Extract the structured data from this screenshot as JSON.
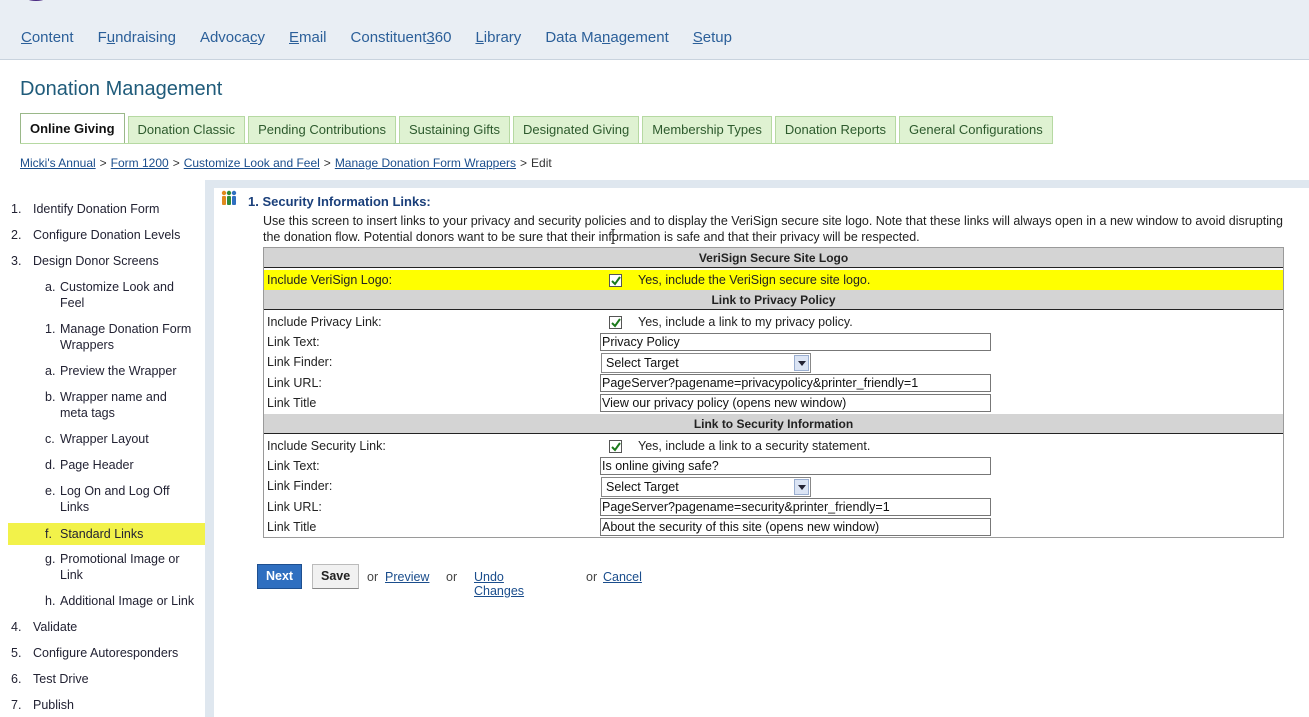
{
  "app": {
    "logo_fragment": "convio"
  },
  "nav": [
    {
      "label": "Content",
      "access": "C",
      "rest": "ontent"
    },
    {
      "label": "Fundraising",
      "access": "u",
      "pre": "F",
      "rest": "ndraising"
    },
    {
      "label": "Advocacy",
      "pre": "Advoca",
      "access": "c",
      "rest": "y"
    },
    {
      "label": "Email",
      "access": "E",
      "rest": "mail"
    },
    {
      "label": "Constituent360",
      "pre": "Constituent",
      "access": "3",
      "rest": "60"
    },
    {
      "label": "Library",
      "access": "L",
      "rest": "ibrary"
    },
    {
      "label": "Data Management",
      "pre": "Data Ma",
      "access": "n",
      "rest": "agement"
    },
    {
      "label": "Setup",
      "access": "S",
      "rest": "etup"
    }
  ],
  "page_title": "Donation Management",
  "tabs": [
    {
      "label": "Online Giving",
      "active": true
    },
    {
      "label": "Donation Classic"
    },
    {
      "label": "Pending Contributions"
    },
    {
      "label": "Sustaining Gifts"
    },
    {
      "label": "Designated Giving"
    },
    {
      "label": "Membership Types"
    },
    {
      "label": "Donation Reports"
    },
    {
      "label": "General Configurations"
    }
  ],
  "breadcrumb": {
    "items": [
      "Micki's Annual",
      "Form 1200",
      "Customize Look and Feel",
      "Manage Donation Form Wrappers"
    ],
    "current": "Edit",
    "sep": ">"
  },
  "steps": [
    {
      "num": "1.",
      "label": "Identify Donation Form"
    },
    {
      "num": "2.",
      "label": "Configure Donation Levels"
    },
    {
      "num": "3.",
      "label": "Design Donor Screens"
    },
    {
      "num": "a.",
      "label1": "Customize Look and",
      "label2": "Feel"
    },
    {
      "num": "1.",
      "label1": "Manage Donation Form",
      "label2": "Wrappers"
    },
    {
      "num": "a.",
      "label": "Preview the Wrapper"
    },
    {
      "num": "b.",
      "label1": "Wrapper name and",
      "label2": "meta tags"
    },
    {
      "num": "c.",
      "label": "Wrapper Layout"
    },
    {
      "num": "d.",
      "label": "Page Header"
    },
    {
      "num": "e.",
      "label1": "Log On and Log Off",
      "label2": "Links"
    },
    {
      "num": "f.",
      "label": "Standard Links",
      "highlighted": true
    },
    {
      "num": "g.",
      "label1": "Promotional Image or",
      "label2": "Link"
    },
    {
      "num": "h.",
      "label": "Additional Image or Link"
    },
    {
      "num": "4.",
      "label": "Validate"
    },
    {
      "num": "5.",
      "label": "Configure Autoresponders"
    },
    {
      "num": "6.",
      "label": "Test Drive"
    },
    {
      "num": "7.",
      "label": "Publish"
    }
  ],
  "section": {
    "title": "1. Security Information Links:",
    "intro": "Use this screen to insert links to your privacy and security policies and to display the VeriSign secure site logo. Note that these links will always open in a new window to avoid disrupting the donation flow. Potential donors want to be sure that their information is safe and that their privacy will be respected."
  },
  "verisign": {
    "header": "VeriSign Secure Site Logo",
    "label": "Include VeriSign Logo:",
    "checked": true,
    "checkbox_text": "Yes, include the VeriSign secure site logo."
  },
  "privacy": {
    "header": "Link to Privacy Policy",
    "include_label": "Include Privacy Link:",
    "checked": true,
    "checkbox_text": "Yes, include a link to my privacy policy.",
    "text_label": "Link Text:",
    "text_value": "Privacy Policy",
    "finder_label": "Link Finder:",
    "finder_value": "Select Target",
    "url_label": "Link URL:",
    "url_value": "PageServer?pagename=privacypolicy&printer_friendly=1",
    "title_label": "Link Title",
    "title_value": "View our privacy policy (opens new window)"
  },
  "security": {
    "header": "Link to Security Information",
    "include_label": "Include Security Link:",
    "checked": true,
    "checkbox_text": "Yes, include a link to a security statement.",
    "text_label": "Link Text:",
    "text_value": "Is online giving safe?",
    "finder_label": "Link Finder:",
    "finder_value": "Select Target",
    "url_label": "Link URL:",
    "url_value": "PageServer?pagename=security&printer_friendly=1",
    "title_label": "Link Title",
    "title_value": "About the security of this site (opens new window)"
  },
  "actions": {
    "next": "Next",
    "save": "Save",
    "or": "or",
    "preview": "Preview",
    "undo": "Undo Changes",
    "cancel": "Cancel"
  },
  "colors": {
    "highlight_yellow": "#ffff00",
    "sidebar_highlight": "#f2f24a",
    "tab_green": "#dff2d2",
    "next_button": "#2f6fc0",
    "title_teal": "#1f5b7a"
  }
}
